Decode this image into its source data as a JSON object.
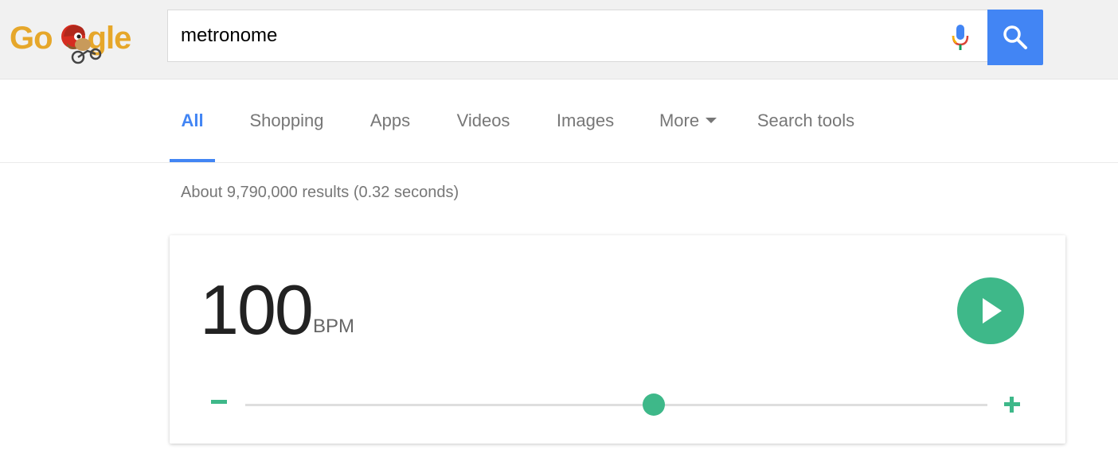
{
  "search": {
    "query": "metronome",
    "mic_icon": "microphone-icon",
    "search_icon": "magnifier-icon"
  },
  "logo": {
    "text": "Google",
    "doodle": "hedgehog-on-bicycle-doodle"
  },
  "tabs": [
    {
      "label": "All",
      "active": true
    },
    {
      "label": "Shopping",
      "active": false
    },
    {
      "label": "Apps",
      "active": false
    },
    {
      "label": "Videos",
      "active": false
    },
    {
      "label": "Images",
      "active": false
    },
    {
      "label": "More",
      "active": false,
      "icon": "caret-down-icon"
    },
    {
      "label": "Search tools",
      "active": false
    }
  ],
  "results": {
    "stats": "About 9,790,000 results (0.32 seconds)"
  },
  "metronome": {
    "bpm": "100",
    "unit": "BPM",
    "slider_position": 0.55,
    "play_icon": "play-icon",
    "decrease_icon": "minus-icon",
    "increase_icon": "plus-icon"
  },
  "colors": {
    "accent_blue": "#4285f4",
    "metronome_green": "#3eb889",
    "logo_gold": "#e6a72a",
    "header_bg": "#f1f1f1",
    "muted_text": "#777777"
  }
}
